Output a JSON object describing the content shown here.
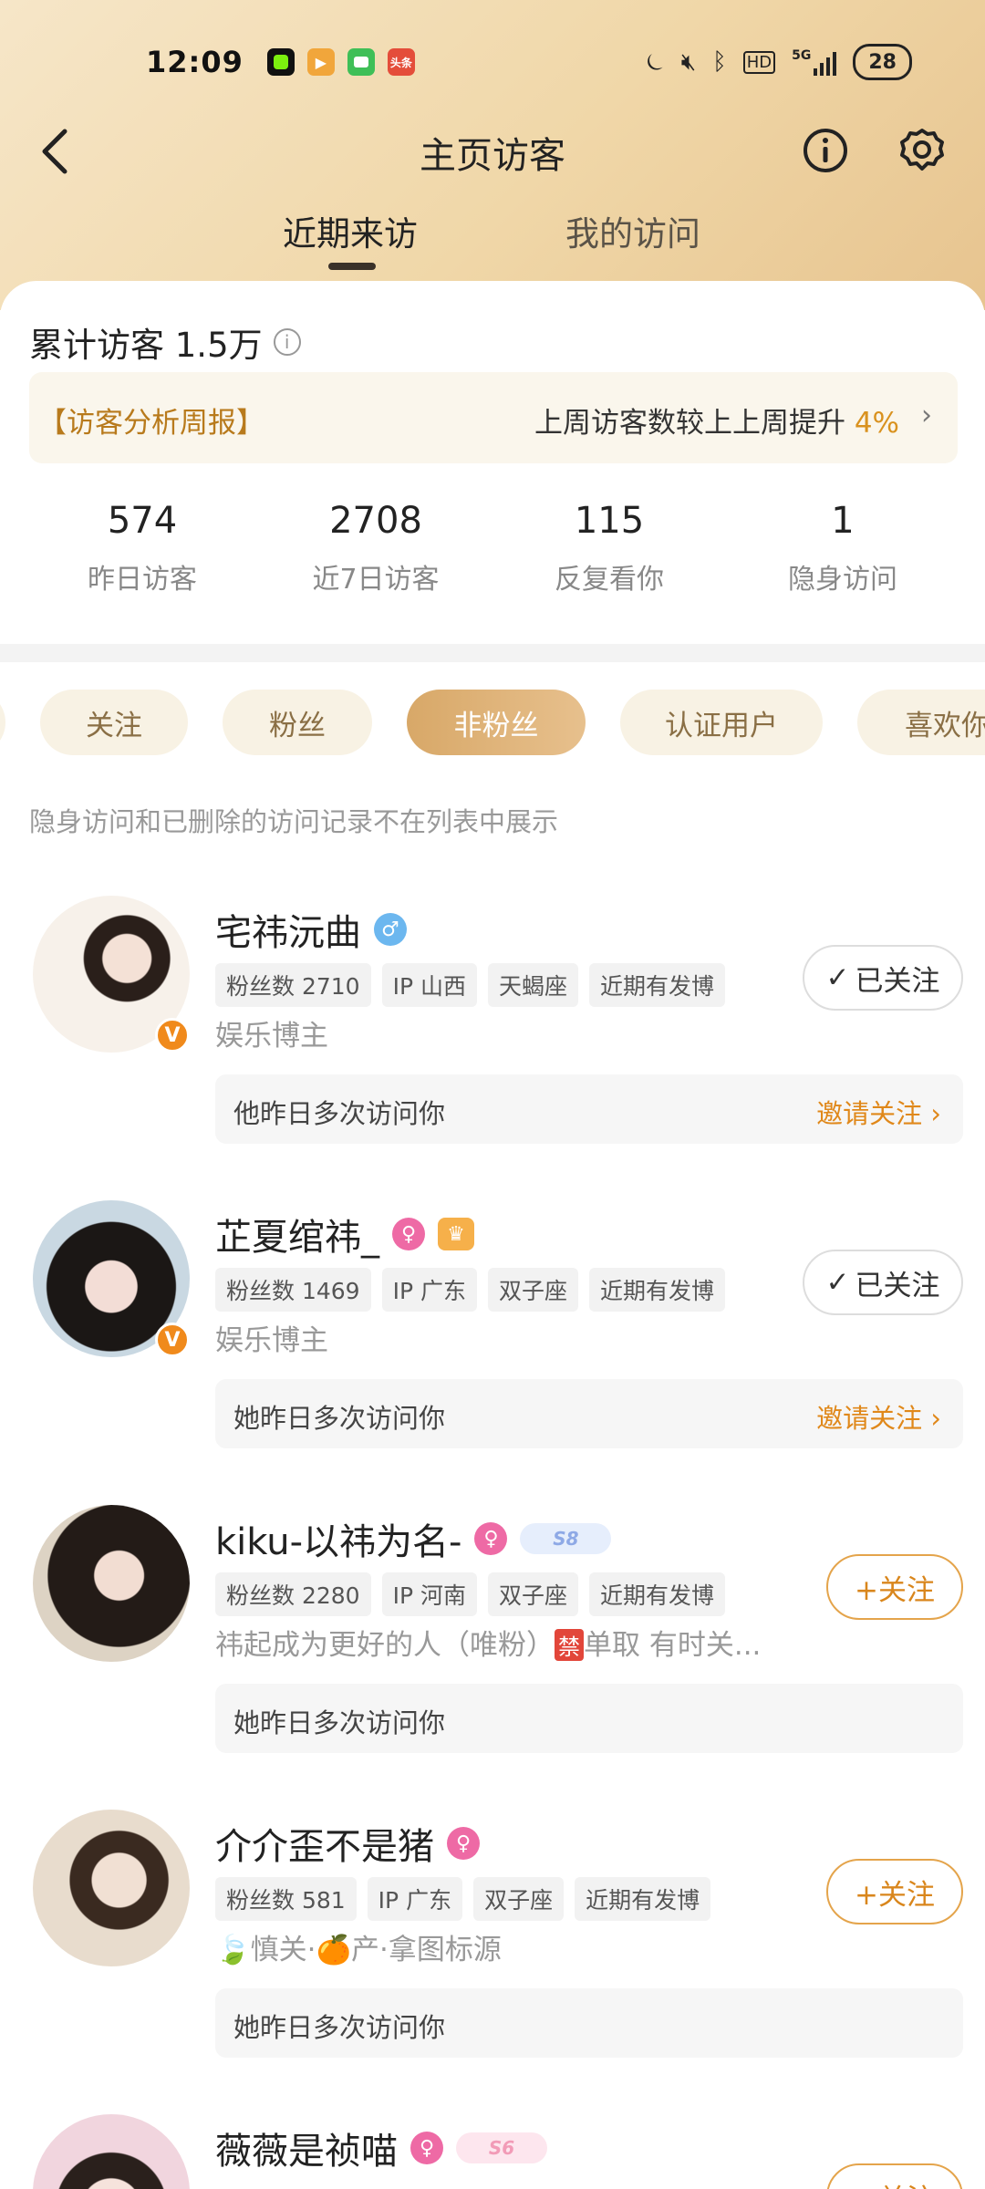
{
  "status_bar": {
    "time": "12:09",
    "battery": "28",
    "network": "5G"
  },
  "header": {
    "title": "主页访客"
  },
  "tabs": [
    {
      "label": "近期来访"
    },
    {
      "label": "我的访问"
    }
  ],
  "summary": {
    "total_label": "累计访客 1.5万",
    "weekly_tag": "【访客分析周报】",
    "weekly_text": "上周访客数较上上周提升",
    "weekly_pct": "4%",
    "stats": [
      {
        "value": "574",
        "label": "昨日访客"
      },
      {
        "value": "2708",
        "label": "近7日访客"
      },
      {
        "value": "115",
        "label": "反复看你"
      },
      {
        "value": "1",
        "label": "隐身访问"
      }
    ]
  },
  "filters": [
    "关注",
    "粉丝",
    "非粉丝",
    "认证用户",
    "喜欢你"
  ],
  "active_filter": "非粉丝",
  "note": "隐身访问和已删除的访问记录不在列表中展示",
  "visitors": [
    {
      "name": "宅祎沅曲",
      "tags": [
        "粉丝数 2710",
        "IP 山西",
        "天蝎座",
        "近期有发博"
      ],
      "desc": "娱乐博主",
      "button": "已关注",
      "visit": "他昨日多次访问你",
      "invite": "邀请关注 ›"
    },
    {
      "name": "芷夏绾祎_",
      "tags": [
        "粉丝数 1469",
        "IP 广东",
        "双子座",
        "近期有发博"
      ],
      "desc": "娱乐博主",
      "button": "已关注",
      "visit": "她昨日多次访问你",
      "invite": "邀请关注 ›"
    },
    {
      "name": "kiku-以祎为名-",
      "tags": [
        "粉丝数 2280",
        "IP 河南",
        "双子座",
        "近期有发博"
      ],
      "desc_pre": "祎起成为更好的人（唯粉）",
      "desc_ban": "禁",
      "desc_post": "单取 有时关...",
      "button": "+关注",
      "visit": "她昨日多次访问你",
      "svip": "S8"
    },
    {
      "name": "介介歪不是猪",
      "tags": [
        "粉丝数 581",
        "IP 广东",
        "双子座",
        "近期有发博"
      ],
      "desc": "🍃慎关·🍊产·拿图标源",
      "button": "+关注",
      "visit": "她昨日多次访问你"
    },
    {
      "name": "薇薇是祯喵",
      "button": "+关注",
      "svip": "S6"
    }
  ]
}
